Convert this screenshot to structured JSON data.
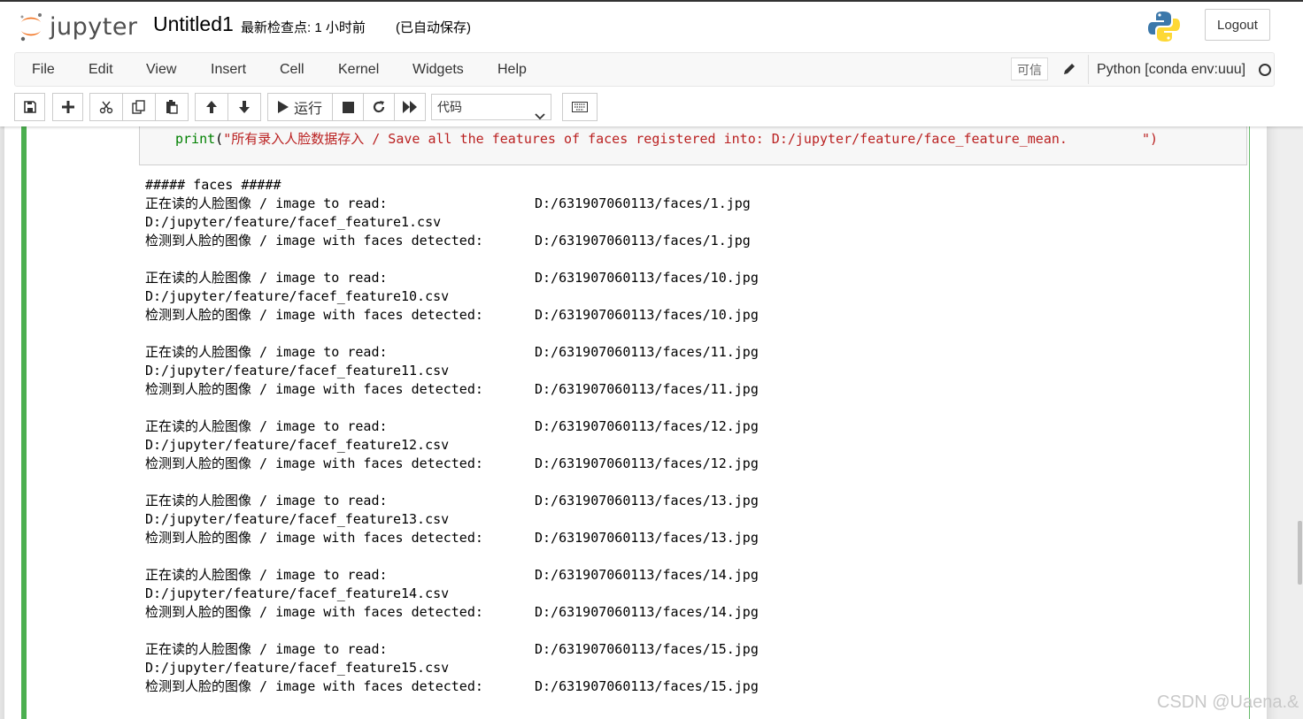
{
  "header": {
    "logo_text": "jupyter",
    "notebook_name": "Untitled1",
    "checkpoint": "最新检查点: 1 小时前",
    "autosave": "(已自动保存)",
    "logout_label": "Logout"
  },
  "menubar": {
    "items": [
      "File",
      "Edit",
      "View",
      "Insert",
      "Cell",
      "Kernel",
      "Widgets",
      "Help"
    ],
    "trusted": "可信",
    "kernel_name": "Python [conda env:uuu]"
  },
  "toolbar": {
    "run_label": "运行",
    "cell_type": "代码",
    "buttons": [
      "save-icon",
      "plus-icon",
      "cut-icon",
      "copy-icon",
      "paste-icon",
      "arrow-up-icon",
      "arrow-down-icon",
      "run-icon",
      "stop-icon",
      "restart-icon",
      "fast-forward-icon",
      "keyboard-icon"
    ]
  },
  "cell": {
    "code": {
      "func": "print",
      "open": "(",
      "string": "\"所有录入人脸数据存入 / Save all the features of faces registered into: D:/jupyter/feature/face_feature_mean.",
      "close_quote": "\")"
    },
    "output": {
      "header": "##### faces #####",
      "blocks": [
        {
          "read_label": "正在读的人脸图像 / image to read:",
          "read_path": "D:/631907060113/faces/1.jpg",
          "csv": "D:/jupyter/feature/facef_feature1.csv",
          "det_label": "检测到人脸的图像 / image with faces detected:",
          "det_path": "D:/631907060113/faces/1.jpg"
        },
        {
          "read_label": "正在读的人脸图像 / image to read:",
          "read_path": "D:/631907060113/faces/10.jpg",
          "csv": "D:/jupyter/feature/facef_feature10.csv",
          "det_label": "检测到人脸的图像 / image with faces detected:",
          "det_path": "D:/631907060113/faces/10.jpg"
        },
        {
          "read_label": "正在读的人脸图像 / image to read:",
          "read_path": "D:/631907060113/faces/11.jpg",
          "csv": "D:/jupyter/feature/facef_feature11.csv",
          "det_label": "检测到人脸的图像 / image with faces detected:",
          "det_path": "D:/631907060113/faces/11.jpg"
        },
        {
          "read_label": "正在读的人脸图像 / image to read:",
          "read_path": "D:/631907060113/faces/12.jpg",
          "csv": "D:/jupyter/feature/facef_feature12.csv",
          "det_label": "检测到人脸的图像 / image with faces detected:",
          "det_path": "D:/631907060113/faces/12.jpg"
        },
        {
          "read_label": "正在读的人脸图像 / image to read:",
          "read_path": "D:/631907060113/faces/13.jpg",
          "csv": "D:/jupyter/feature/facef_feature13.csv",
          "det_label": "检测到人脸的图像 / image with faces detected:",
          "det_path": "D:/631907060113/faces/13.jpg"
        },
        {
          "read_label": "正在读的人脸图像 / image to read:",
          "read_path": "D:/631907060113/faces/14.jpg",
          "csv": "D:/jupyter/feature/facef_feature14.csv",
          "det_label": "检测到人脸的图像 / image with faces detected:",
          "det_path": "D:/631907060113/faces/14.jpg"
        },
        {
          "read_label": "正在读的人脸图像 / image to read:",
          "read_path": "D:/631907060113/faces/15.jpg",
          "csv": "D:/jupyter/feature/facef_feature15.csv",
          "det_label": "检测到人脸的图像 / image with faces detected:",
          "det_path": "D:/631907060113/faces/15.jpg"
        }
      ]
    }
  },
  "watermark": "CSDN @Uaena.&"
}
